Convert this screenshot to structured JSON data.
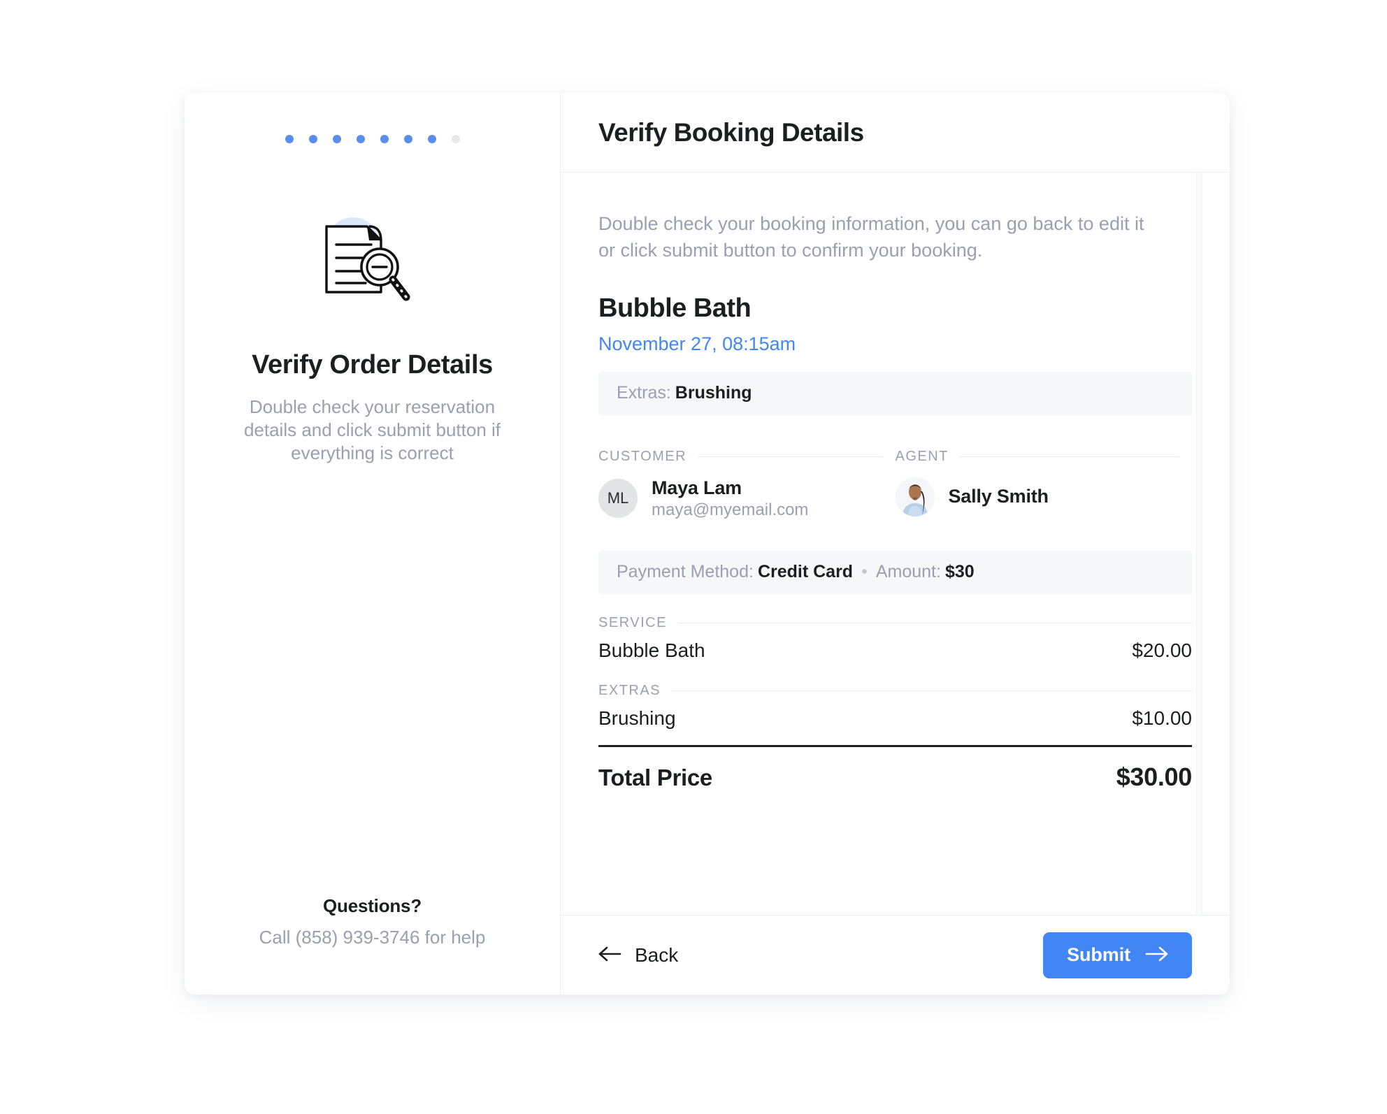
{
  "stepper": {
    "total_steps": 8,
    "active_steps": 7,
    "active_color": "#5b8def",
    "inactive_color": "#e6e8ec"
  },
  "left_panel": {
    "illustration_name": "document-magnifier-illustration",
    "title": "Verify Order Details",
    "subtitle": "Double check your reservation details and click submit button if everything is correct",
    "footer": {
      "heading": "Questions?",
      "help_text": "Call (858) 939-3746 for help"
    }
  },
  "right_panel": {
    "header_title": "Verify Booking Details",
    "intro": "Double check your booking information, you can go back to edit it or click submit button to confirm your booking.",
    "booking": {
      "service_name": "Bubble Bath",
      "date_time": "November 27, 08:15am",
      "date_color": "#4285f4",
      "extras_strip": {
        "label": "Extras:",
        "value": "Brushing"
      },
      "payment_strip": {
        "method_label": "Payment Method:",
        "method_value": "Credit Card",
        "separator": "•",
        "amount_label": "Amount:",
        "amount_value": "$30"
      }
    },
    "customer": {
      "section_label": "CUSTOMER",
      "initials": "ML",
      "name": "Maya Lam",
      "email": "maya@myemail.com"
    },
    "agent": {
      "section_label": "AGENT",
      "name": "Sally Smith",
      "avatar_type": "photo"
    },
    "service_section": {
      "section_label": "SERVICE",
      "items": [
        {
          "name": "Bubble Bath",
          "price": "$20.00"
        }
      ]
    },
    "extras_section": {
      "section_label": "EXTRAS",
      "items": [
        {
          "name": "Brushing",
          "price": "$10.00"
        }
      ]
    },
    "total": {
      "label": "Total Price",
      "amount": "$30.00"
    },
    "footer": {
      "back_label": "Back",
      "back_icon": "arrow-left-icon",
      "submit_label": "Submit",
      "submit_icon": "arrow-right-icon",
      "submit_color": "#4285f4"
    }
  }
}
